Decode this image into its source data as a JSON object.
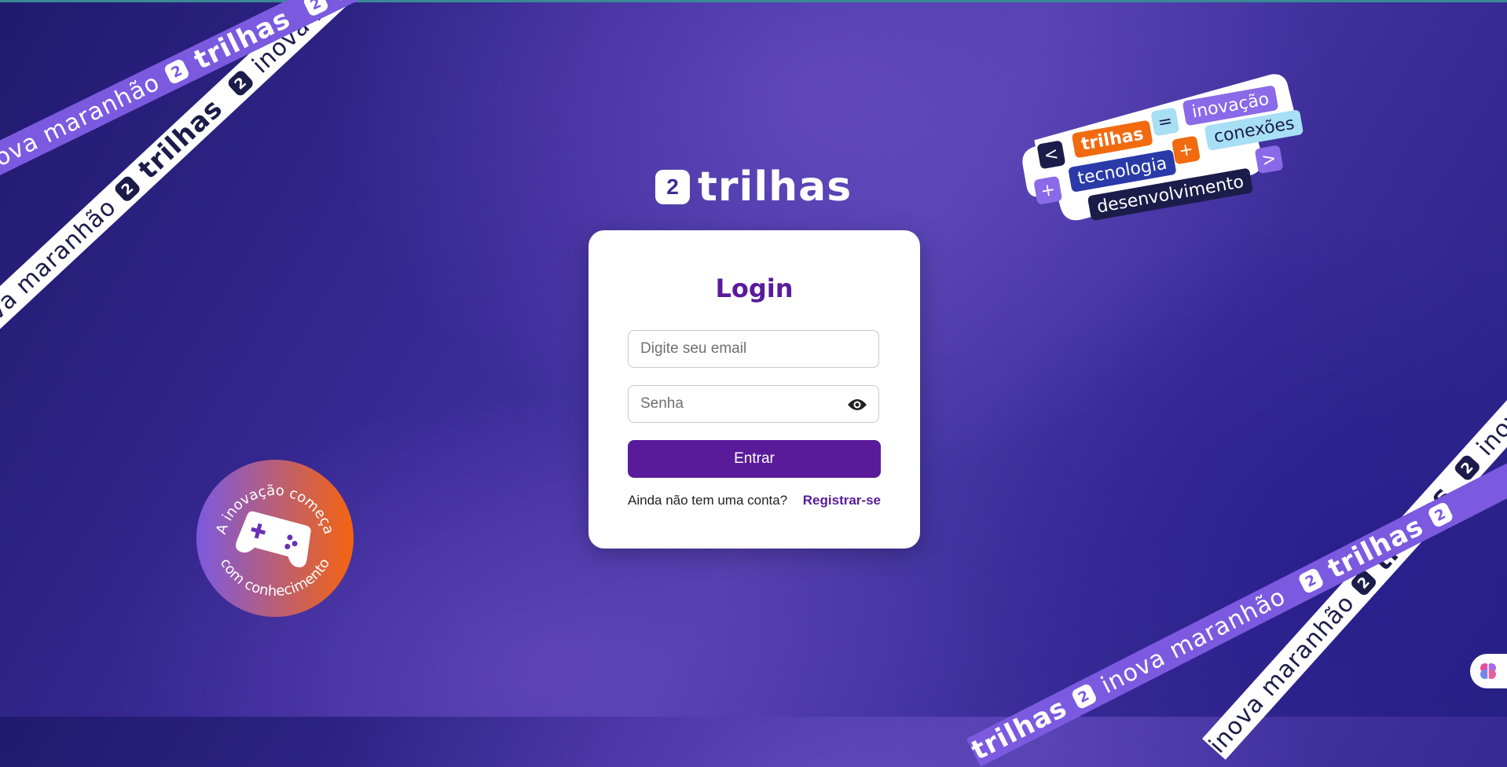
{
  "brand": {
    "name": "trilhas",
    "mark": "2"
  },
  "ribbon": {
    "word_brand": "trilhas",
    "word_a": "inova maranhão",
    "word_b": "inova ma"
  },
  "login": {
    "title": "Login",
    "email_placeholder": "Digite seu email",
    "password_placeholder": "Senha",
    "submit_label": "Entrar",
    "signup_prompt": "Ainda não tem uma conta?",
    "signup_link": "Registrar-se"
  },
  "sticker": {
    "lt": "<",
    "gt": ">",
    "eq": "=",
    "plus": "+",
    "trilhas": "trilhas",
    "inovacao": "inovação",
    "tecnologia": "tecnologia",
    "conexoes": "conexões",
    "desenvolvimento": "desenvolvimento"
  },
  "badge": {
    "top_text": "A inovação começa",
    "bottom_text": "com conhecimento"
  },
  "colors": {
    "accent": "#5a1b9a",
    "ribbon_purple": "#7b5ae0",
    "orange": "#f26a10",
    "navy": "#1c1c4a"
  },
  "icons": {
    "password_toggle": "eye-icon",
    "badge_icon": "gamepad-icon",
    "widget_icon": "brain-icon"
  }
}
